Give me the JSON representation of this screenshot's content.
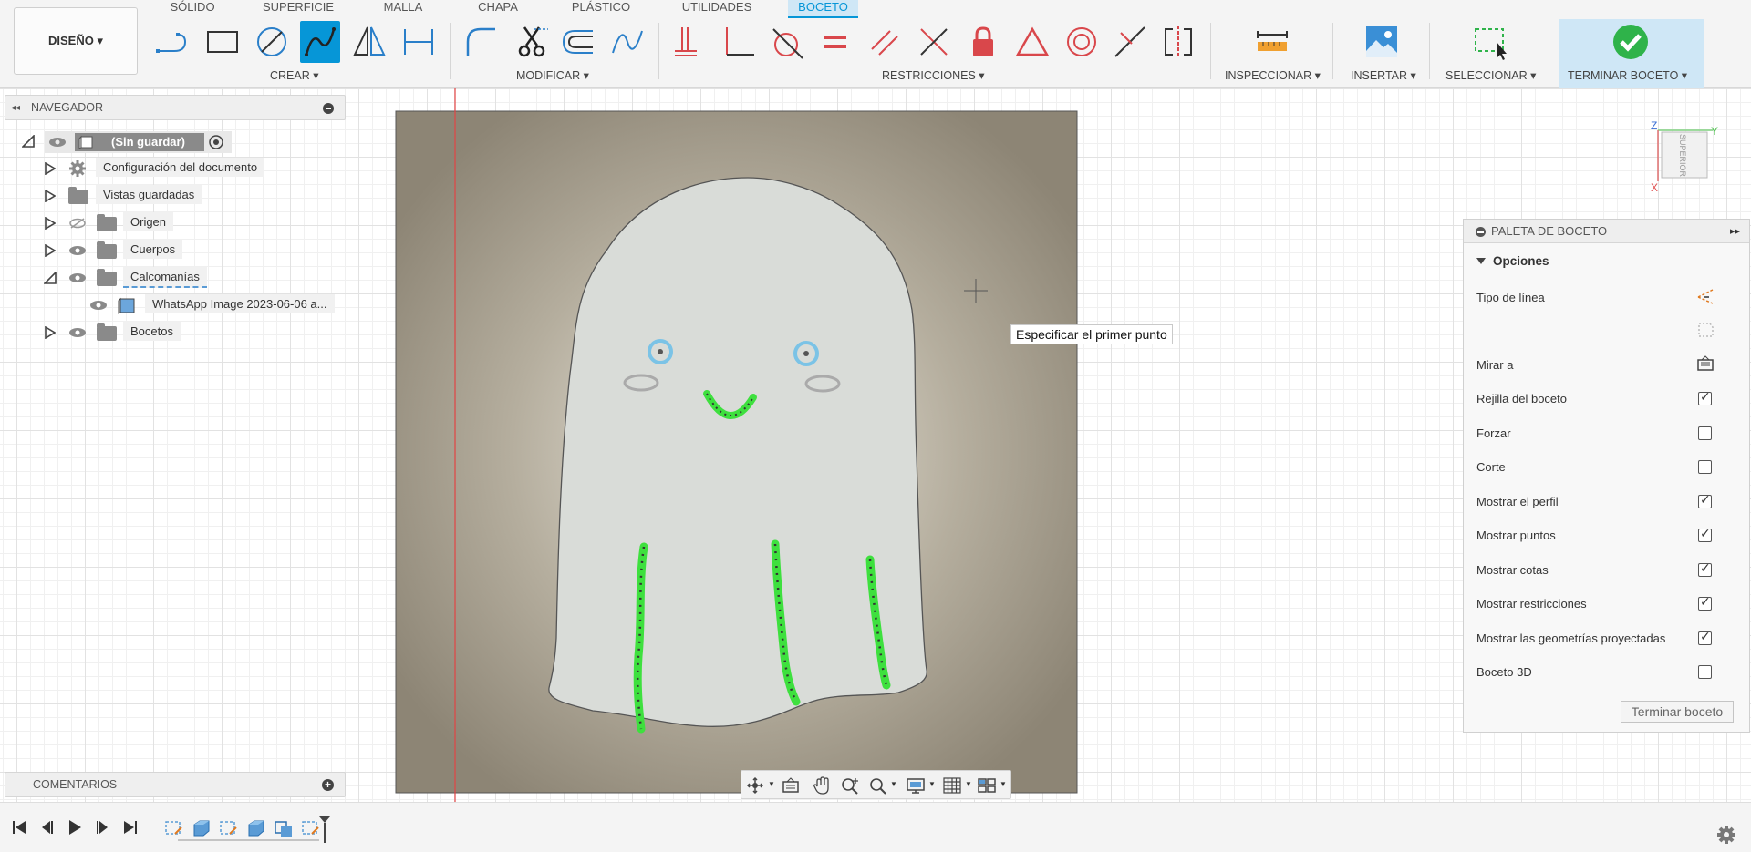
{
  "workspace": {
    "label": "DISEÑO ▾"
  },
  "tabs": [
    {
      "label": "SÓLIDO"
    },
    {
      "label": "SUPERFICIE"
    },
    {
      "label": "MALLA"
    },
    {
      "label": "CHAPA"
    },
    {
      "label": "PLÁSTICO"
    },
    {
      "label": "UTILIDADES"
    },
    {
      "label": "BOCETO"
    }
  ],
  "groups": {
    "create": "CREAR ▾",
    "modify": "MODIFICAR ▾",
    "constraints": "RESTRICCIONES ▾",
    "inspect": "INSPECCIONAR ▾",
    "insert": "INSERTAR ▾",
    "select": "SELECCIONAR ▾",
    "finish": "TERMINAR BOCETO ▾"
  },
  "browser": {
    "title": "NAVEGADOR",
    "root": "(Sin guardar)",
    "items": [
      {
        "label": "Configuración del documento"
      },
      {
        "label": "Vistas guardadas"
      },
      {
        "label": "Origen"
      },
      {
        "label": "Cuerpos"
      },
      {
        "label": "Calcomanías"
      },
      {
        "label": "WhatsApp Image 2023-06-06 a..."
      },
      {
        "label": "Bocetos"
      }
    ]
  },
  "comments": {
    "title": "COMENTARIOS"
  },
  "tooltip": "Especificar el primer punto",
  "viewcube": {
    "face": "SUPERIOR",
    "axis_z": "Z",
    "axis_y": "Y",
    "axis_x": "X"
  },
  "palette": {
    "title": "PALETA DE BOCETO",
    "section": "Opciones",
    "rows": [
      {
        "label": "Tipo de línea",
        "kind": "icon"
      },
      {
        "label": "",
        "kind": "icon"
      },
      {
        "label": "Mirar a",
        "kind": "icon"
      },
      {
        "label": "Rejilla del boceto",
        "kind": "check",
        "checked": true
      },
      {
        "label": "Forzar",
        "kind": "check",
        "checked": false
      },
      {
        "label": "Corte",
        "kind": "check",
        "checked": false
      },
      {
        "label": "Mostrar el perfil",
        "kind": "check",
        "checked": true
      },
      {
        "label": "Mostrar puntos",
        "kind": "check",
        "checked": true
      },
      {
        "label": "Mostrar cotas",
        "kind": "check",
        "checked": true
      },
      {
        "label": "Mostrar restricciones",
        "kind": "check",
        "checked": true
      },
      {
        "label": "Mostrar las geometrías proyectadas",
        "kind": "check",
        "checked": true
      },
      {
        "label": "Boceto 3D",
        "kind": "check",
        "checked": false
      }
    ],
    "finish_button": "Terminar boceto"
  },
  "colors": {
    "accent": "#0696d7",
    "finish_green": "#2fb34a",
    "constraint_red": "#d9474b",
    "decal_bg": "#8d8575",
    "ghost_fill": "#d9dcd8",
    "sketch_point": "#3ee03e"
  }
}
